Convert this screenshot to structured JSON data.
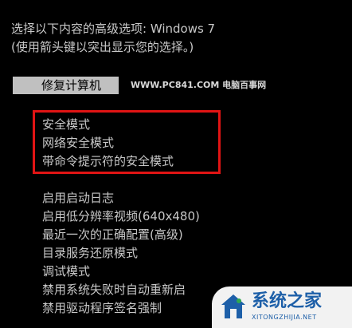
{
  "header": {
    "line1": "选择以下内容的高级选项: Windows 7",
    "line2": "(使用箭头键以突出显示您的选择。)"
  },
  "selected_option": "修复计算机",
  "watermark_top": "WWW.PC841.COM 电脑百事网",
  "highlighted_options": [
    "安全模式",
    "网络安全模式",
    "带命令提示符的安全模式"
  ],
  "other_options": [
    "启用启动日志",
    "启用低分辨率视频(640x480)",
    "最近一次的正确配置(高级)",
    "目录服务还原模式",
    "调试模式",
    "禁用系统失败时自动重新启",
    "禁用驱动程序签名强制"
  ],
  "logo": {
    "title": "系统之家",
    "subtitle": "XITONGZHIJIA.NET"
  },
  "colors": {
    "background": "#000000",
    "text": "#c8c8c8",
    "selection_bg": "#c0c0c0",
    "highlight_border": "#e11414",
    "logo_blue": "#1d5fa8"
  }
}
